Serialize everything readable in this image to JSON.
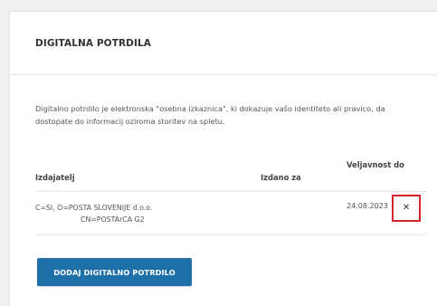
{
  "section": {
    "title": "DIGITALNA POTRDILA",
    "description": "Digitalno potrdilo je elektronska \"osebna izkaznica\", ki dokazuje vašo identiteto ali pravico, da dostopate do informacij oziroma storitev na spletu."
  },
  "table": {
    "headers": {
      "issuer": "Izdajatelj",
      "issued_to": "Izdano za",
      "validity": "Veljavnost do"
    },
    "rows": [
      {
        "issuer_line1": "C=SI, O=POSTA SLOVENIJE d.o.o.",
        "issuer_line2": "CN=POSTArCA G2",
        "issued_to": "",
        "validity": "24.08.2023",
        "remove_label": "✕"
      }
    ]
  },
  "actions": {
    "add_label": "DODAJ DIGITALNO POTRDILO"
  },
  "colors": {
    "primary": "#1f6fa8",
    "highlight": "#d6232a"
  }
}
